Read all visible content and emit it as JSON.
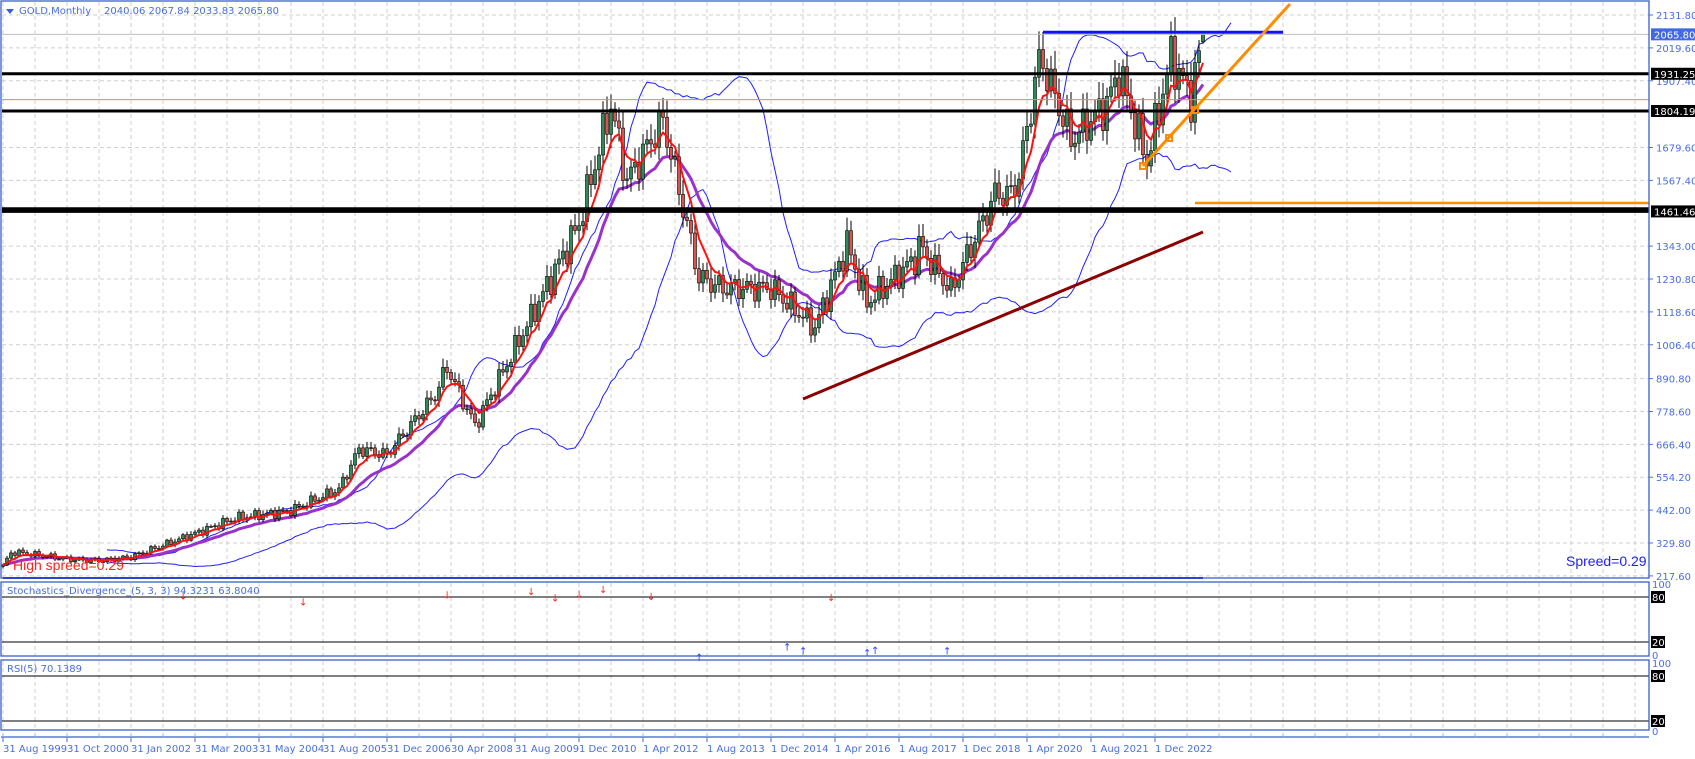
{
  "header": {
    "symbol": "GOLD,Monthly",
    "ohlc": "2040.06 2067.84 2033.83 2065.80"
  },
  "stoch_panel": {
    "label": "Stochastics_Divergence_(5, 3, 3) 94.3231 63.8040",
    "levels": [
      "100",
      "80",
      "20",
      "0"
    ]
  },
  "rsi_panel": {
    "label": "RSI(5) 70.1389",
    "levels": [
      "100",
      "80",
      "20",
      "0"
    ]
  },
  "annotations": {
    "high_spread": "High spreed=0.29",
    "spread": "Spreed=0.29"
  },
  "colors": {
    "bull": "#2e8b57",
    "bear": "#d9534f",
    "bands": "#1f1fff",
    "fast_ma": "#ff1010",
    "slow_ma": "#9932cc",
    "trend_orange": "#ff8c00",
    "support_dark": "#8b0000",
    "axis": "#4a6ee0"
  },
  "chart_data": {
    "type": "candlestick",
    "title": "GOLD,Monthly",
    "y_ticks": [
      "2131.80",
      "2019.60",
      "1907.40",
      "1679.60",
      "1567.40",
      "1343.00",
      "1230.80",
      "1118.60",
      "1006.40",
      "890.80",
      "778.60",
      "666.40",
      "554.20",
      "442.00",
      "329.80",
      "217.60"
    ],
    "ylim": [
      217.6,
      2131.8
    ],
    "x_ticks": [
      "31 Aug 1999",
      "31 Oct 2000",
      "31 Jan 2002",
      "31 Mar 2003",
      "31 May 2004",
      "31 Aug 2005",
      "31 Dec 2006",
      "30 Apr 2008",
      "31 Aug 2009",
      "1 Dec 2010",
      "1 Apr 2012",
      "1 Aug 2013",
      "1 Dec 2014",
      "1 Apr 2016",
      "1 Aug 2017",
      "1 Dec 2018",
      "1 Apr 2020",
      "1 Aug 2021",
      "1 Dec 2022"
    ],
    "x_tick_dates": [
      "1999-08",
      "2000-10",
      "2002-01",
      "2003-03",
      "2004-05",
      "2005-08",
      "2006-12",
      "2008-04",
      "2009-08",
      "2010-12",
      "2012-04",
      "2013-08",
      "2014-12",
      "2016-04",
      "2017-08",
      "2018-12",
      "2020-04",
      "2021-08",
      "2022-12"
    ],
    "close_keypoints": [
      [
        "1999-08",
        255
      ],
      [
        "1999-10",
        300
      ],
      [
        "2000-12",
        272
      ],
      [
        "2001-06",
        270
      ],
      [
        "2002-01",
        282
      ],
      [
        "2002-12",
        345
      ],
      [
        "2003-12",
        415
      ],
      [
        "2004-12",
        438
      ],
      [
        "2005-12",
        513
      ],
      [
        "2006-05",
        650
      ],
      [
        "2006-12",
        632
      ],
      [
        "2007-12",
        834
      ],
      [
        "2008-03",
        930
      ],
      [
        "2008-10",
        730
      ],
      [
        "2009-12",
        1100
      ],
      [
        "2010-12",
        1420
      ],
      [
        "2011-08",
        1825
      ],
      [
        "2011-12",
        1565
      ],
      [
        "2012-09",
        1775
      ],
      [
        "2013-06",
        1235
      ],
      [
        "2013-12",
        1200
      ],
      [
        "2014-12",
        1200
      ],
      [
        "2015-11",
        1065
      ],
      [
        "2016-07",
        1350
      ],
      [
        "2016-12",
        1150
      ],
      [
        "2017-12",
        1300
      ],
      [
        "2018-01",
        1345
      ],
      [
        "2018-09",
        1190
      ],
      [
        "2019-08",
        1520
      ],
      [
        "2019-12",
        1520
      ],
      [
        "2020-02",
        1585
      ],
      [
        "2020-07",
        1975
      ],
      [
        "2020-08",
        1965
      ],
      [
        "2021-03",
        1707
      ],
      [
        "2021-12",
        1828
      ],
      [
        "2022-03",
        1937
      ],
      [
        "2022-10",
        1633
      ],
      [
        "2023-04",
        1990
      ],
      [
        "2023-09",
        1848
      ],
      [
        "2023-12",
        2065.8
      ]
    ],
    "price_tags": [
      {
        "value": 2065.8,
        "text": "2065.80",
        "style": "current"
      },
      {
        "value": 1931.25,
        "text": "1931.25",
        "style": "level"
      },
      {
        "value": 1804.19,
        "text": "1804.19",
        "style": "level"
      },
      {
        "value": 1461.46,
        "text": "1461.46",
        "style": "level"
      }
    ],
    "horizontal_levels": [
      1931.25,
      1804.19,
      1461.46,
      1470.5
    ],
    "orange_level_thin": 1843,
    "orange_level_thick": 1490,
    "resistance_blue": 2073,
    "indicators": {
      "bollinger": [
        20,
        2
      ],
      "fast_ma": 6,
      "slow_ma": 18,
      "stochastic": [
        5,
        3,
        3
      ],
      "rsi": 5
    }
  }
}
